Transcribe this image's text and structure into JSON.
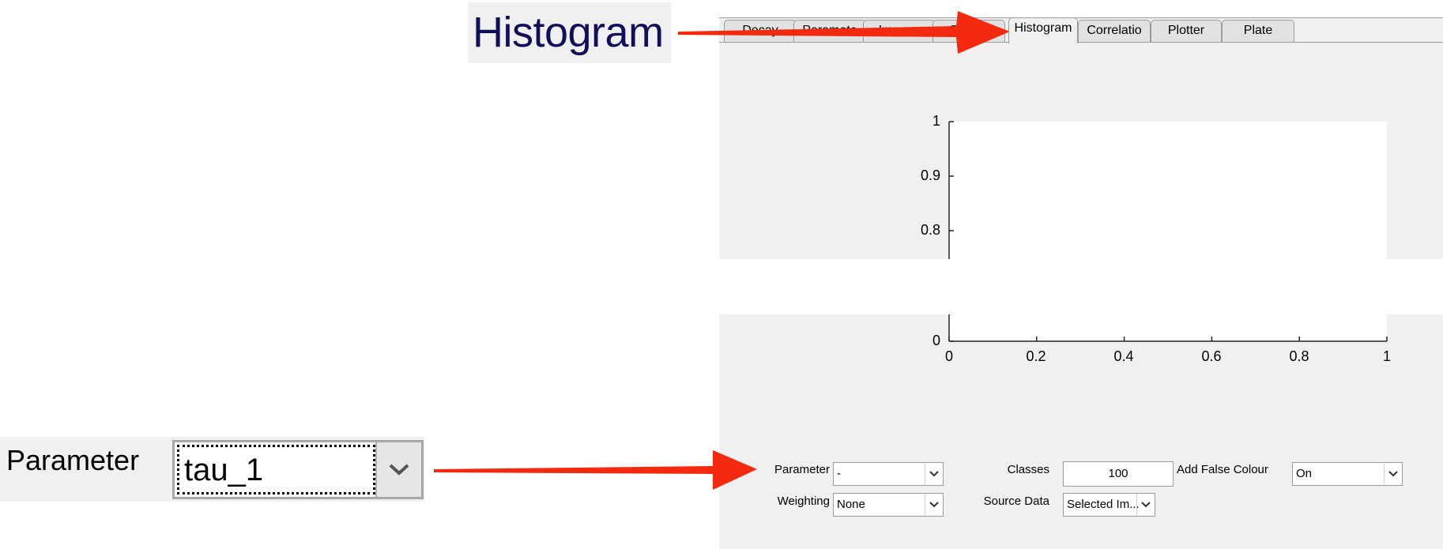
{
  "zoom_tab": {
    "label": "Histogram"
  },
  "tabs": [
    {
      "label": "Decay",
      "active": false
    },
    {
      "label": "Paramete",
      "active": false
    },
    {
      "label": "Images",
      "active": false
    },
    {
      "label": "Gallery",
      "active": false
    },
    {
      "label": "Histogram",
      "active": true
    },
    {
      "label": "Correlatio",
      "active": false
    },
    {
      "label": "Plotter",
      "active": false
    },
    {
      "label": "Plate",
      "active": false
    }
  ],
  "chart_data": {
    "type": "bar",
    "title": "",
    "xlabel": "",
    "ylabel": "",
    "xlim": [
      0,
      1
    ],
    "ylim": [
      0,
      1
    ],
    "x_ticks": [
      "0",
      "0.2",
      "0.4",
      "0.6",
      "0.8",
      "1"
    ],
    "y_ticks": [
      "1",
      "0.9",
      "0.8",
      "0"
    ],
    "values": []
  },
  "controls": {
    "parameter": {
      "label": "Parameter",
      "value": "-"
    },
    "weighting": {
      "label": "Weighting",
      "value": "None"
    },
    "classes": {
      "label": "Classes",
      "value": "100"
    },
    "source_data": {
      "label": "Source Data",
      "value": "Selected Im..."
    },
    "false_colour": {
      "label": "Add False Colour",
      "value": "On"
    }
  },
  "zoom_param": {
    "label": "Parameter",
    "value": "tau_1"
  },
  "colors": {
    "arrow": "#f42a10",
    "panel": "#f0f0f0"
  }
}
